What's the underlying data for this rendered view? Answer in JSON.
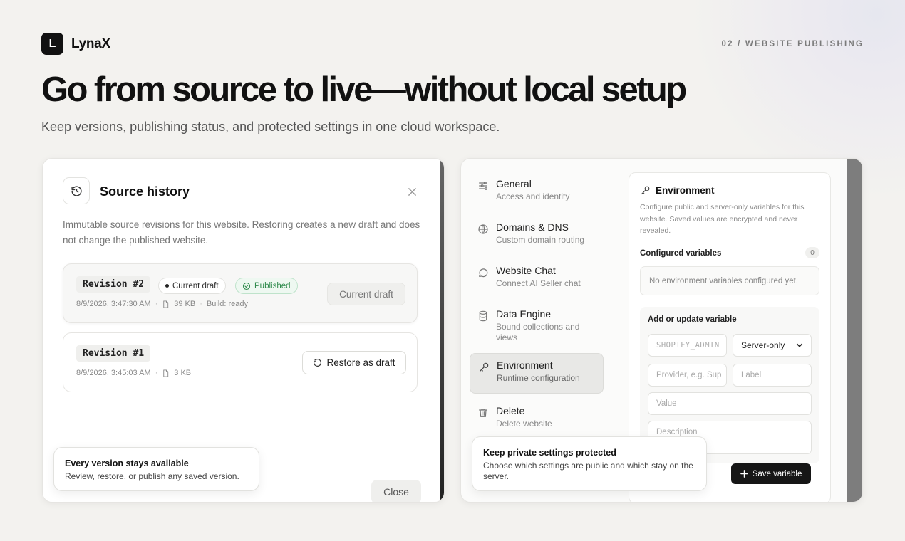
{
  "brand": {
    "logo_letter": "L",
    "name": "LynaX"
  },
  "kicker": "02 / WEBSITE PUBLISHING",
  "headline": "Go from source to live—without local setup",
  "subhead": "Keep versions, publishing status, and protected settings in one cloud workspace.",
  "source_history": {
    "title": "Source history",
    "description": "Immutable source revisions for this website. Restoring creates a new draft and does not change the published website.",
    "revisions": [
      {
        "label": "Revision #2",
        "badge_draft": "Current draft",
        "badge_published": "Published",
        "timestamp": "8/9/2026, 3:47:30 AM",
        "size": "39 KB",
        "build": "Build: ready",
        "action": "Current draft"
      },
      {
        "label": "Revision #1",
        "timestamp": "8/9/2026, 3:45:03 AM",
        "size": "3 KB",
        "action": "Restore as draft"
      }
    ],
    "close_label": "Close"
  },
  "callouts": {
    "left": {
      "title": "Every version stays available",
      "text": "Review, restore, or publish any saved version."
    },
    "right": {
      "title": "Keep private settings protected",
      "text": "Choose which settings are public and which stay on the server."
    }
  },
  "settings_nav": [
    {
      "title": "General",
      "sub": "Access and identity",
      "icon": "sliders-icon"
    },
    {
      "title": "Domains & DNS",
      "sub": "Custom domain routing",
      "icon": "globe-icon"
    },
    {
      "title": "Website Chat",
      "sub": "Connect AI Seller chat",
      "icon": "chat-icon"
    },
    {
      "title": "Data Engine",
      "sub": "Bound collections and views",
      "icon": "database-icon"
    },
    {
      "title": "Environment",
      "sub": "Runtime configuration",
      "icon": "key-icon",
      "active": true
    },
    {
      "title": "Delete",
      "sub": "Delete website",
      "icon": "trash-icon"
    }
  ],
  "environment": {
    "title": "Environment",
    "description": "Configure public and server-only variables for this website. Saved values are encrypted and never revealed.",
    "configured_label": "Configured variables",
    "configured_count": "0",
    "empty_text": "No environment variables configured yet.",
    "add_label": "Add or update variable",
    "key_placeholder": "SHOPIFY_ADMIN",
    "visibility_value": "Server-only",
    "provider_placeholder": "Provider, e.g. Sup",
    "label_placeholder": "Label",
    "value_placeholder": "Value",
    "description_placeholder": "Description",
    "save_label": "Save variable"
  }
}
